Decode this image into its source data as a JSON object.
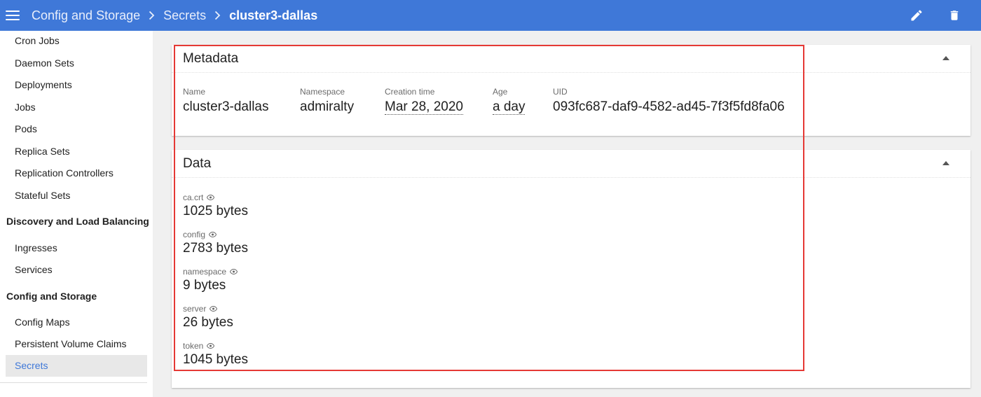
{
  "topbar": {
    "breadcrumbs": [
      "Config and Storage",
      "Secrets"
    ],
    "current": "cluster3-dallas"
  },
  "sidebar": {
    "items": [
      {
        "label": "Cron Jobs"
      },
      {
        "label": "Daemon Sets"
      },
      {
        "label": "Deployments"
      },
      {
        "label": "Jobs"
      },
      {
        "label": "Pods"
      },
      {
        "label": "Replica Sets"
      },
      {
        "label": "Replication Controllers"
      },
      {
        "label": "Stateful Sets"
      }
    ],
    "section_discovery": "Discovery and Load Balancing",
    "discovery_items": [
      {
        "label": "Ingresses"
      },
      {
        "label": "Services"
      }
    ],
    "section_config": "Config and Storage",
    "config_items": [
      {
        "label": "Config Maps"
      },
      {
        "label": "Persistent Volume Claims"
      },
      {
        "label": "Secrets"
      }
    ]
  },
  "metadata": {
    "title": "Metadata",
    "fields": [
      {
        "label": "Name",
        "value": "cluster3-dallas"
      },
      {
        "label": "Namespace",
        "value": "admiralty"
      },
      {
        "label": "Creation time",
        "value": "Mar 28, 2020"
      },
      {
        "label": "Age",
        "value": "a day"
      },
      {
        "label": "UID",
        "value": "093fc687-daf9-4582-ad45-7f3f5fd8fa06"
      }
    ]
  },
  "data": {
    "title": "Data",
    "entries": [
      {
        "key": "ca.crt",
        "size": "1025 bytes"
      },
      {
        "key": "config",
        "size": "2783 bytes"
      },
      {
        "key": "namespace",
        "size": "9 bytes"
      },
      {
        "key": "server",
        "size": "26 bytes"
      },
      {
        "key": "token",
        "size": "1045 bytes"
      }
    ]
  },
  "colors": {
    "topbar": "#3f78d8",
    "active_nav": "#3f78d8",
    "highlight": "#e53935"
  }
}
